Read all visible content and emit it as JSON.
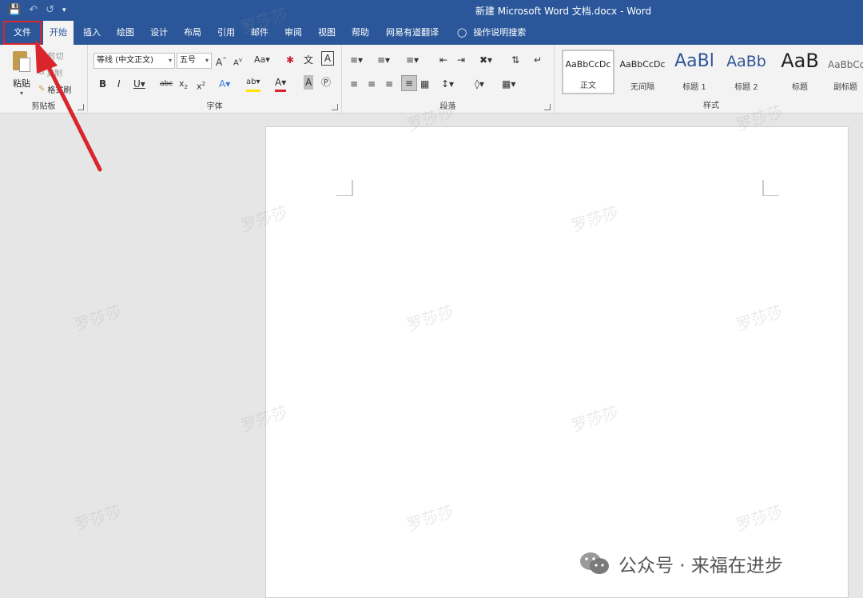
{
  "titlebar": {
    "doc_title": "新建 Microsoft Word 文档.docx  -  Word"
  },
  "tabs": [
    {
      "label": "文件"
    },
    {
      "label": "开始"
    },
    {
      "label": "插入"
    },
    {
      "label": "绘图"
    },
    {
      "label": "设计"
    },
    {
      "label": "布局"
    },
    {
      "label": "引用"
    },
    {
      "label": "邮件"
    },
    {
      "label": "审阅"
    },
    {
      "label": "视图"
    },
    {
      "label": "帮助"
    },
    {
      "label": "网易有道翻译"
    }
  ],
  "tell_me": "操作说明搜索",
  "clipboard": {
    "paste": "粘贴",
    "cut": "剪切",
    "copy": "复制",
    "format_painter": "格式刷",
    "group": "剪贴板"
  },
  "font": {
    "family": "等线 (中文正文)",
    "size": "五号",
    "group": "字体"
  },
  "paragraph": {
    "group": "段落"
  },
  "styles": {
    "group": "样式",
    "items": [
      {
        "preview": "AaBbCcDc",
        "name": "正文"
      },
      {
        "preview": "AaBbCcDc",
        "name": "无间隔"
      },
      {
        "preview": "AaBl",
        "name": "标题 1"
      },
      {
        "preview": "AaBb",
        "name": "标题 2"
      },
      {
        "preview": "AaB",
        "name": "标题"
      },
      {
        "preview": "AaBbCc",
        "name": "副标题"
      }
    ]
  },
  "watermark": "罗莎莎",
  "footer": {
    "text": "公众号 · 来福在进步"
  },
  "colors": {
    "accent": "#2b579a",
    "highlight_box": "#d9262c",
    "arrow": "#d9262c"
  }
}
